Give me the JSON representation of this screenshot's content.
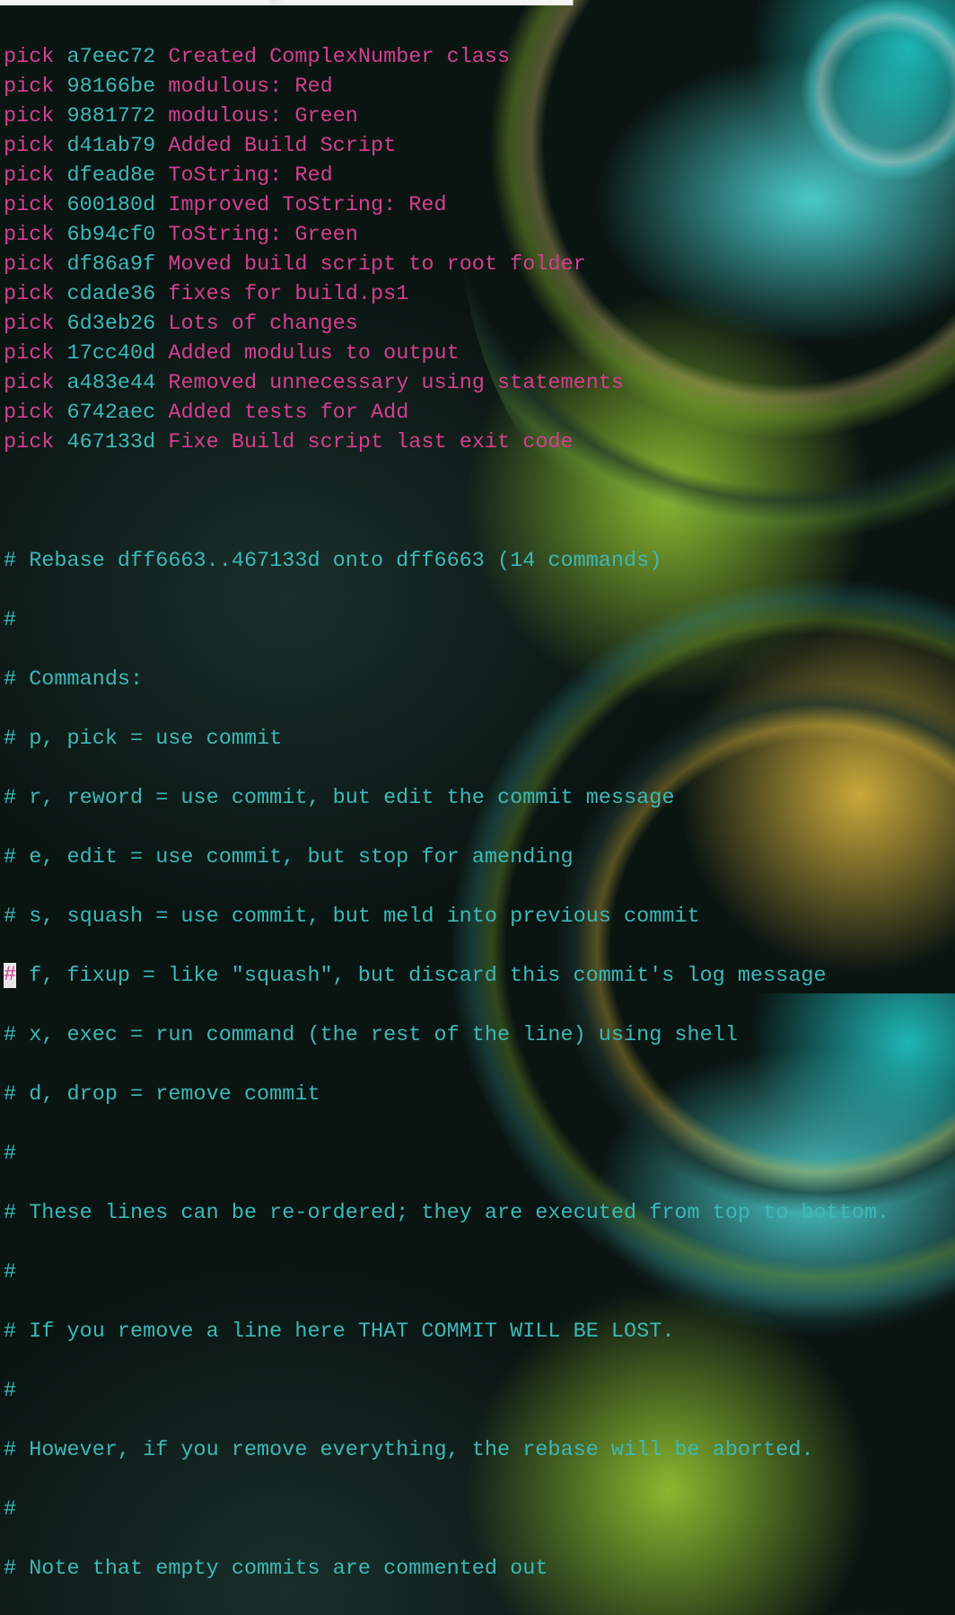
{
  "commits": [
    {
      "action": "pick",
      "hash": "a7eec72",
      "message": "Created ComplexNumber class"
    },
    {
      "action": "pick",
      "hash": "98166be",
      "message": "modulous: Red"
    },
    {
      "action": "pick",
      "hash": "9881772",
      "message": "modulous: Green"
    },
    {
      "action": "pick",
      "hash": "d41ab79",
      "message": "Added Build Script"
    },
    {
      "action": "pick",
      "hash": "dfead8e",
      "message": "ToString: Red"
    },
    {
      "action": "pick",
      "hash": "600180d",
      "message": "Improved ToString: Red"
    },
    {
      "action": "pick",
      "hash": "6b94cf0",
      "message": "ToString: Green"
    },
    {
      "action": "pick",
      "hash": "df86a9f",
      "message": "Moved build script to root folder"
    },
    {
      "action": "pick",
      "hash": "cdade36",
      "message": "fixes for build.ps1"
    },
    {
      "action": "pick",
      "hash": "6d3eb26",
      "message": "Lots of changes"
    },
    {
      "action": "pick",
      "hash": "17cc40d",
      "message": "Added modulus to output"
    },
    {
      "action": "pick",
      "hash": "a483e44",
      "message": "Removed unnecessary using statements"
    },
    {
      "action": "pick",
      "hash": "6742aec",
      "message": "Added tests for Add"
    },
    {
      "action": "pick",
      "hash": "467133d",
      "message": "Fixe Build script last exit code"
    }
  ],
  "comments": {
    "rebase_header": "# Rebase dff6663..467133d onto dff6663 (14 commands)",
    "hash2": "#",
    "commands_label": "# Commands:",
    "p": "# p, pick = use commit",
    "r": "# r, reword = use commit, but edit the commit message",
    "e": "# e, edit = use commit, but stop for amending",
    "s": "# s, squash = use commit, but meld into previous commit",
    "f": " f, fixup = like \"squash\", but discard this commit's log message",
    "x": "# x, exec = run command (the rest of the line) using shell",
    "d": "# d, drop = remove commit",
    "hash3": "#",
    "reorder": "# These lines can be re-ordered; they are executed from top to bottom.",
    "hash4": "#",
    "remove_line": "# If you remove a line here THAT COMMIT WILL BE LOST.",
    "hash5": "#",
    "remove_all": "# However, if you remove everything, the rebase will be aborted.",
    "hash6": "#",
    "empty": "# Note that empty commits are commented out"
  }
}
